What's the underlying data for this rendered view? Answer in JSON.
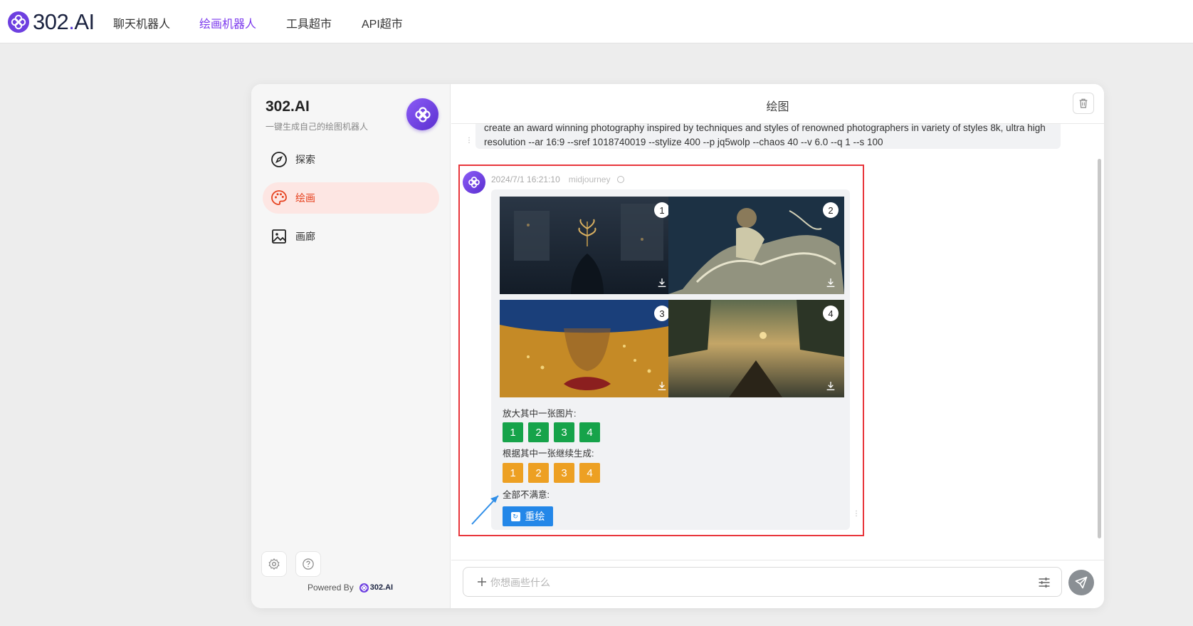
{
  "topnav": {
    "brand": "302",
    "brand_dot": ".",
    "brand_suffix": "AI",
    "links": [
      "聊天机器人",
      "绘画机器人",
      "工具超市",
      "API超市"
    ],
    "active_index": 1
  },
  "sidebar": {
    "title": "302.AI",
    "subtitle": "一键生成自己的绘图机器人",
    "items": [
      {
        "label": "探索",
        "icon": "compass-icon"
      },
      {
        "label": "绘画",
        "icon": "palette-icon"
      },
      {
        "label": "画廊",
        "icon": "image-icon"
      }
    ],
    "active_index": 1,
    "powered_by": "Powered By",
    "powered_brand": "302.AI"
  },
  "main": {
    "title": "绘图",
    "prompt_text": "create an award winning photography inspired by techniques and styles of renowned photographers in variety of styles 8k, ultra high resolution --ar 16:9 --sref 1018740019 --stylize 400 --p jq5wolp --chaos 40 --v 6.0  --q 1  --s 100",
    "message": {
      "timestamp": "2024/7/1 16:21:10",
      "model": "midjourney",
      "images": [
        {
          "num": "1",
          "subject": "hand holding golden plant in rain"
        },
        {
          "num": "2",
          "subject": "dancer in flowing water dress"
        },
        {
          "num": "3",
          "subject": "lips with water droplets under hat"
        },
        {
          "num": "4",
          "subject": "boat on misty river at sunrise"
        }
      ],
      "upscale_label": "放大其中一张图片:",
      "upscale_buttons": [
        "1",
        "2",
        "3",
        "4"
      ],
      "variation_label": "根据其中一张继续生成:",
      "variation_buttons": [
        "1",
        "2",
        "3",
        "4"
      ],
      "reroll_label": "全部不满意:",
      "reroll_button": "重绘"
    },
    "input_placeholder": "你想画些什么"
  },
  "colors": {
    "accent": "#7c3aed",
    "active_item_bg": "#fde6e3",
    "active_item_text": "#e6421f",
    "upscale_green": "#16a34a",
    "variation_orange": "#eda023",
    "redraw_blue": "#2387e8",
    "highlight_red": "#e8363c"
  }
}
